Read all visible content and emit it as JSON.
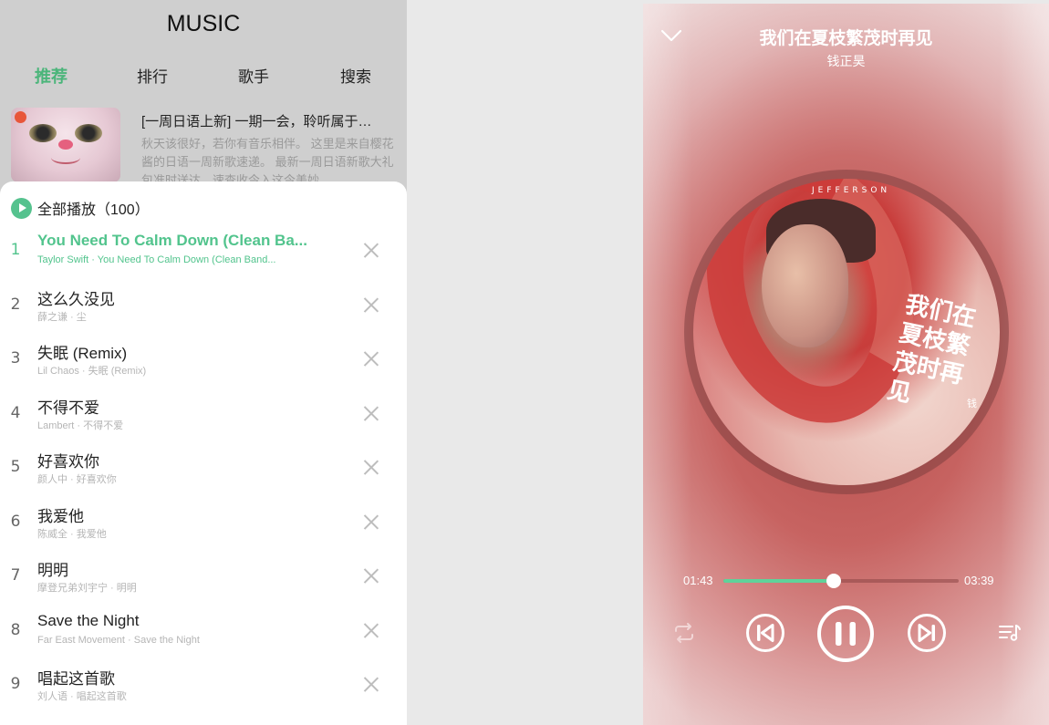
{
  "left": {
    "app_title": "MUSIC",
    "tabs": [
      {
        "label": "推荐",
        "active": true
      },
      {
        "label": "排行",
        "active": false
      },
      {
        "label": "歌手",
        "active": false
      },
      {
        "label": "搜索",
        "active": false
      }
    ],
    "playlist": {
      "title": "[一周日语上新] 一期一会，聆听属于…",
      "description": "秋天该很好，若你有音乐相伴。 这里是来自樱花酱的日语一周新歌速递。 最新一周日语新歌大礼包准时送达，速查收今入这今美妙"
    },
    "queue": {
      "play_all_label": "全部播放（100）",
      "songs": [
        {
          "index": "1",
          "title": "You Need To Calm Down (Clean Ba...",
          "subtitle": "Taylor Swift · You Need To Calm Down (Clean Band...",
          "active": true
        },
        {
          "index": "2",
          "title": "这么久没见",
          "subtitle": "薛之谦 · 尘",
          "active": false
        },
        {
          "index": "3",
          "title": "失眠 (Remix)",
          "subtitle": "Lil Chaos · 失眠 (Remix)",
          "active": false
        },
        {
          "index": "4",
          "title": "不得不爱",
          "subtitle": "Lambert · 不得不爱",
          "active": false
        },
        {
          "index": "5",
          "title": "好喜欢你",
          "subtitle": "颜人中 · 好喜欢你",
          "active": false
        },
        {
          "index": "6",
          "title": "我爱他",
          "subtitle": "陈威全 · 我爱他",
          "active": false
        },
        {
          "index": "7",
          "title": "明明",
          "subtitle": "摩登兄弟刘宇宁 · 明明",
          "active": false
        },
        {
          "index": "8",
          "title": "Save the Night",
          "subtitle": "Far East Movement · Save the Night",
          "active": false
        },
        {
          "index": "9",
          "title": "唱起这首歌",
          "subtitle": "刘人语 · 唱起这首歌",
          "active": false
        }
      ]
    },
    "colors": {
      "accent": "#52c48d",
      "panel_bg": "#cfcfcf"
    }
  },
  "player": {
    "song_title": "我们在夏枝繁茂时再见",
    "artist": "钱正昊",
    "album_art": {
      "brand": "JEFFERSON",
      "title_text": "我们在夏枝繁茂时再见",
      "side_text": "钱"
    },
    "current_time": "01:43",
    "duration": "03:39",
    "progress": 0.47,
    "controls": [
      "chevron-down-icon",
      "repeat-icon",
      "previous-icon",
      "pause-icon",
      "next-icon",
      "playlist-icon"
    ],
    "colors": {
      "progress_fill": "#5fd29a",
      "background": "#c45e5b"
    }
  }
}
